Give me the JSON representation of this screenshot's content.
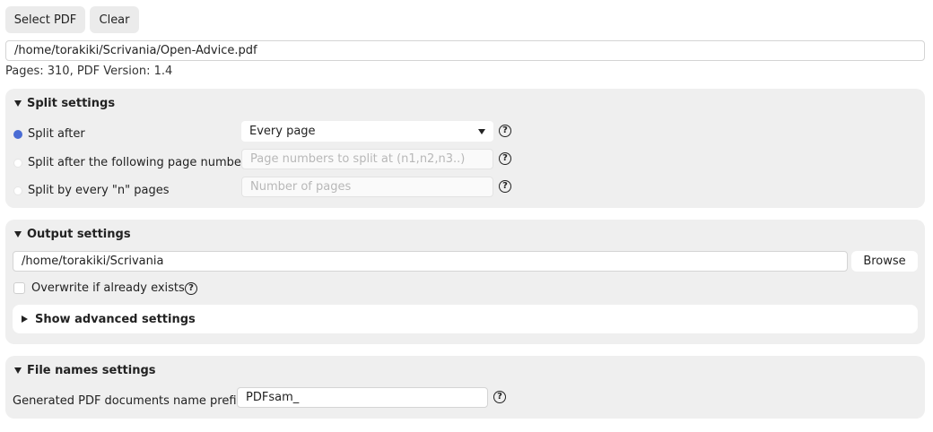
{
  "toolbar": {
    "select_pdf_label": "Select PDF",
    "clear_label": "Clear"
  },
  "file": {
    "path": "/home/torakiki/Scrivania/Open-Advice.pdf",
    "info": "Pages: 310, PDF Version: 1.4"
  },
  "split_settings": {
    "title": "Split settings",
    "options": [
      {
        "label": "Split after",
        "selected": true,
        "control_value": "Every page"
      },
      {
        "label": "Split after the following page numbers",
        "selected": false,
        "placeholder": "Page numbers to split at (n1,n2,n3..)"
      },
      {
        "label": "Split by every \"n\" pages",
        "selected": false,
        "placeholder": "Number of pages"
      }
    ]
  },
  "output_settings": {
    "title": "Output settings",
    "directory": "/home/torakiki/Scrivania",
    "browse_label": "Browse",
    "overwrite_label": "Overwrite if already exists",
    "overwrite_checked": false,
    "advanced_label": "Show advanced settings"
  },
  "file_names_settings": {
    "title": "File names settings",
    "prefix_label": "Generated PDF documents name prefix:",
    "prefix_value": "PDFsam_"
  },
  "help_glyph": "?",
  "colors": {
    "accent": "#4a6cd4",
    "panel_bg": "#efefef",
    "button_bg": "#ebebeb"
  },
  "icons": [
    "help-icon",
    "collapse-triangle-icon",
    "expand-triangle-icon",
    "dropdown-caret-icon"
  ]
}
